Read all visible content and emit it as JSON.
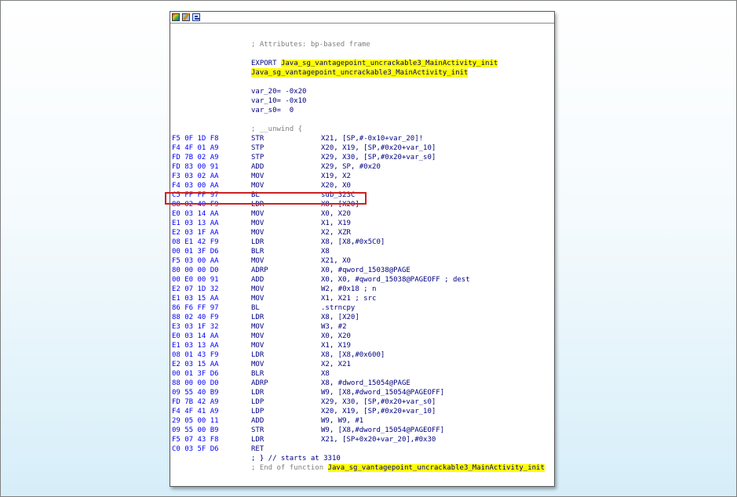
{
  "window": {
    "icons": [
      "color-palette-icon",
      "edit-icon",
      "graph-view-icon"
    ]
  },
  "header": {
    "attributes_comment": "; Attributes: bp-based frame",
    "export_keyword": "EXPORT",
    "export_symbol": "Java_sg_vantagepoint_uncrackable3_MainActivity_init",
    "function_label": "Java_sg_vantagepoint_uncrackable3_MainActivity_init",
    "vars": [
      "var_20= -0x20",
      "var_10= -0x10",
      "var_s0=  0"
    ],
    "unwind": "; __unwind {"
  },
  "instructions": [
    {
      "bytes": "F5 0F 1D F8",
      "mnem": "STR",
      "ops": "X21, [SP,#-0x10+var_20]!"
    },
    {
      "bytes": "F4 4F 01 A9",
      "mnem": "STP",
      "ops": "X20, X19, [SP,#0x20+var_10]"
    },
    {
      "bytes": "FD 7B 02 A9",
      "mnem": "STP",
      "ops": "X29, X30, [SP,#0x20+var_s0]"
    },
    {
      "bytes": "FD 83 00 91",
      "mnem": "ADD",
      "ops": "X29, SP, #0x20"
    },
    {
      "bytes": "F3 03 02 AA",
      "mnem": "MOV",
      "ops": "X19, X2"
    },
    {
      "bytes": "F4 03 00 AA",
      "mnem": "MOV",
      "ops": "X20, X0"
    },
    {
      "bytes": "C5 FF FF 97",
      "mnem": "BL",
      "ops": "sub_323C"
    },
    {
      "bytes": "88 02 40 F9",
      "mnem": "LDR",
      "ops": "X8, [X20]"
    },
    {
      "bytes": "E0 03 14 AA",
      "mnem": "MOV",
      "ops": "X0, X20"
    },
    {
      "bytes": "E1 03 13 AA",
      "mnem": "MOV",
      "ops": "X1, X19"
    },
    {
      "bytes": "E2 03 1F AA",
      "mnem": "MOV",
      "ops": "X2, XZR"
    },
    {
      "bytes": "08 E1 42 F9",
      "mnem": "LDR",
      "ops": "X8, [X8,#0x5C0]"
    },
    {
      "bytes": "00 01 3F D6",
      "mnem": "BLR",
      "ops": "X8"
    },
    {
      "bytes": "F5 03 00 AA",
      "mnem": "MOV",
      "ops": "X21, X0"
    },
    {
      "bytes": "80 00 00 D0",
      "mnem": "ADRP",
      "ops": "X0, #qword_15038@PAGE"
    },
    {
      "bytes": "00 E0 00 91",
      "mnem": "ADD",
      "ops": "X0, X0, #qword_15038@PAGEOFF ; dest"
    },
    {
      "bytes": "E2 07 1D 32",
      "mnem": "MOV",
      "ops": "W2, #0x18 ; n"
    },
    {
      "bytes": "E1 03 15 AA",
      "mnem": "MOV",
      "ops": "X1, X21 ; src"
    },
    {
      "bytes": "86 F6 FF 97",
      "mnem": "BL",
      "ops": ".strncpy"
    },
    {
      "bytes": "88 02 40 F9",
      "mnem": "LDR",
      "ops": "X8, [X20]"
    },
    {
      "bytes": "E3 03 1F 32",
      "mnem": "MOV",
      "ops": "W3, #2"
    },
    {
      "bytes": "E0 03 14 AA",
      "mnem": "MOV",
      "ops": "X0, X20"
    },
    {
      "bytes": "E1 03 13 AA",
      "mnem": "MOV",
      "ops": "X1, X19"
    },
    {
      "bytes": "08 01 43 F9",
      "mnem": "LDR",
      "ops": "X8, [X8,#0x600]"
    },
    {
      "bytes": "E2 03 15 AA",
      "mnem": "MOV",
      "ops": "X2, X21"
    },
    {
      "bytes": "00 01 3F D6",
      "mnem": "BLR",
      "ops": "X8"
    },
    {
      "bytes": "88 00 00 D0",
      "mnem": "ADRP",
      "ops": "X8, #dword_15054@PAGE"
    },
    {
      "bytes": "09 55 40 B9",
      "mnem": "LDR",
      "ops": "W9, [X8,#dword_15054@PAGEOFF]"
    },
    {
      "bytes": "FD 7B 42 A9",
      "mnem": "LDP",
      "ops": "X29, X30, [SP,#0x20+var_s0]"
    },
    {
      "bytes": "F4 4F 41 A9",
      "mnem": "LDP",
      "ops": "X20, X19, [SP,#0x20+var_10]"
    },
    {
      "bytes": "29 05 00 11",
      "mnem": "ADD",
      "ops": "W9, W9, #1"
    },
    {
      "bytes": "09 55 00 B9",
      "mnem": "STR",
      "ops": "W9, [X8,#dword_15054@PAGEOFF]"
    },
    {
      "bytes": "F5 07 43 F8",
      "mnem": "LDR",
      "ops": "X21, [SP+0x20+var_20],#0x30"
    },
    {
      "bytes": "C0 03 5F D6",
      "mnem": "RET",
      "ops": ""
    }
  ],
  "footer": {
    "unwind_end": "; } // starts at 3310",
    "end_prefix": "; End of function",
    "end_symbol": "Java_sg_vantagepoint_uncrackable3_MainActivity_init"
  },
  "colors": {
    "bytes": "#0000ff",
    "code": "#000080",
    "comment": "#7f7f7f",
    "highlight": "#ffff00",
    "selection_box": "#cc2222"
  },
  "highlighted_instruction": "sub_323C"
}
